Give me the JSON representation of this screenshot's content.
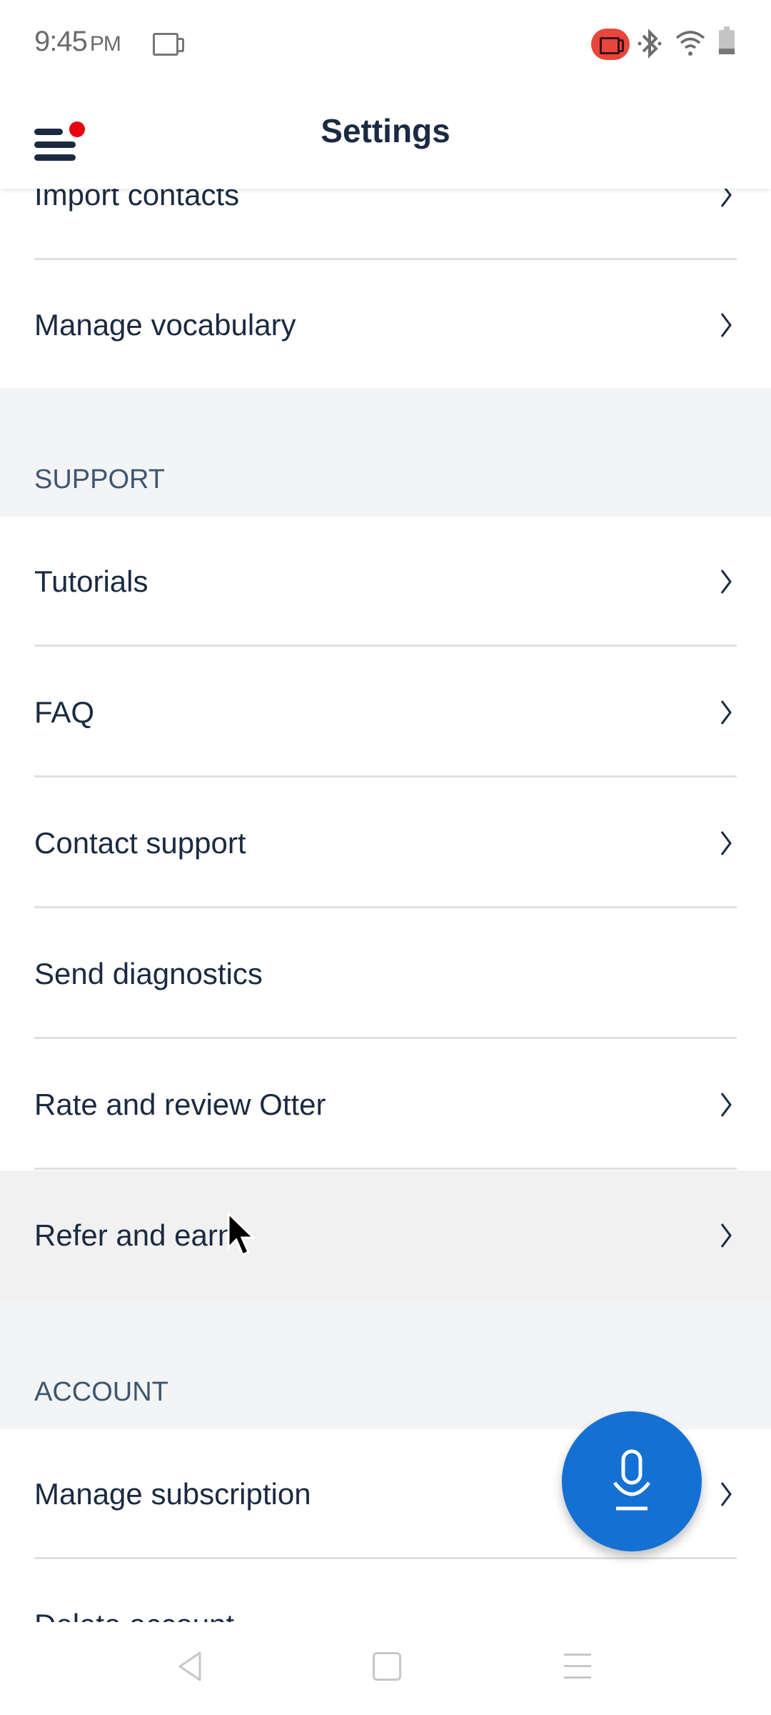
{
  "status_bar": {
    "time": "9:45",
    "ampm": "PM",
    "icons": [
      "screen-record-icon",
      "screen-record-active-icon",
      "bluetooth-icon",
      "wifi-icon",
      "battery-icon"
    ],
    "record_color": "#e8453c"
  },
  "header": {
    "title": "Settings",
    "menu_icon": "hamburger-menu-icon",
    "notification_dot_color": "#e60012"
  },
  "rows_top": [
    {
      "label": "Import contacts",
      "chevron": true
    },
    {
      "label": "Manage vocabulary",
      "chevron": true
    }
  ],
  "sections": {
    "support": {
      "title": "SUPPORT",
      "items": [
        {
          "label": "Tutorials",
          "chevron": true
        },
        {
          "label": "FAQ",
          "chevron": true
        },
        {
          "label": "Contact support",
          "chevron": true
        },
        {
          "label": "Send diagnostics",
          "chevron": false
        },
        {
          "label": "Rate and review Otter",
          "chevron": true
        },
        {
          "label": "Refer and earn",
          "chevron": true,
          "pressed": true
        }
      ]
    },
    "account": {
      "title": "ACCOUNT",
      "items": [
        {
          "label": "Manage subscription",
          "chevron": true
        },
        {
          "label": "Delete account",
          "chevron": false
        }
      ]
    }
  },
  "fab": {
    "icon": "microphone-icon",
    "color": "#1570d4"
  },
  "nav_bar": {
    "icons": [
      "back-icon",
      "home-icon",
      "recents-icon"
    ]
  }
}
